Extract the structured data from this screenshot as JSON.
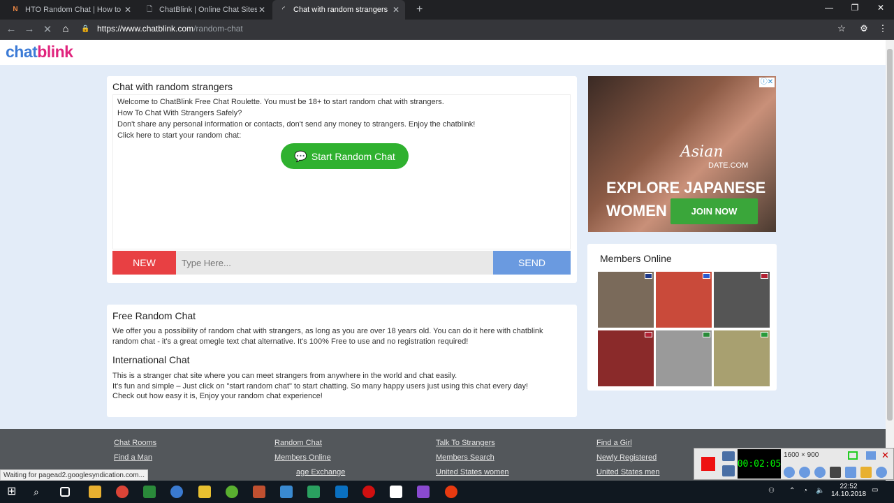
{
  "browser": {
    "tabs": [
      {
        "title": "HTO Random Chat | How to Chat",
        "icon": "news-icon"
      },
      {
        "title": "ChatBlink | Online Chat Sites",
        "icon": "document-icon"
      },
      {
        "title": "Chat with random strangers",
        "icon": "loading-icon"
      }
    ],
    "new_tab": "+",
    "url_host": "https://www.chatblink.com",
    "url_path": "/random-chat"
  },
  "site": {
    "logo_part1": "chat",
    "logo_part2": "blink"
  },
  "chat": {
    "title": "Chat with random strangers",
    "lines": [
      "Welcome to ChatBlink Free Chat Roulette. You must be 18+ to start random chat with strangers.",
      "How To Chat With Strangers Safely?",
      "Don't share any personal information or contacts, don't send any money to strangers. Enjoy the chatblink!",
      "Click here to start your random chat:"
    ],
    "start_label": "Start Random Chat",
    "new_label": "NEW",
    "input_placeholder": "Type Here...",
    "send_label": "SEND"
  },
  "info": {
    "h1": "Free Random Chat",
    "p1": "We offer you a possibility of random chat with strangers, as long as you are over 18 years old. You can do it here with chatblink random chat - it's a great omegle text chat alternative. It's 100% Free to use and no registration required!",
    "h2": "International Chat",
    "p2_lines": [
      "This is a stranger chat site where you can meet strangers from anywhere in the world and chat easily.",
      "It's fun and simple – Just click on \"start random chat\" to start chatting. So many happy users just using this chat every day!",
      "Check out how easy it is, Enjoy your random chat experience!"
    ]
  },
  "ad": {
    "brand": "Asian",
    "brand2": "DATE.COM",
    "headline1": "EXPLORE JAPANESE",
    "headline2": "WOMEN",
    "cta": "JOIN NOW"
  },
  "members": {
    "title": "Members Online",
    "photos": [
      {
        "bg": "#7a6a5a",
        "flag": "#1f3a8a"
      },
      {
        "bg": "#c94a3a",
        "flag": "#2a5bd0"
      },
      {
        "bg": "#555555",
        "flag": "#b22234"
      },
      {
        "bg": "#8a2a2a",
        "flag": "#b22234"
      },
      {
        "bg": "#9a9a9a",
        "flag": "#2a8a3a"
      },
      {
        "bg": "#a8a070",
        "flag": "#2a9a3a"
      }
    ]
  },
  "footer": {
    "col1": [
      "Chat Rooms",
      "Find a Man"
    ],
    "col2": [
      "Random Chat",
      "Members Online",
      "age Exchange"
    ],
    "col3": [
      "Talk To Strangers",
      "Members Search",
      "United States women"
    ],
    "col4": [
      "Find a Girl",
      "Newly Registered",
      "United States men"
    ]
  },
  "status_text": "Waiting for pagead2.googlesyndication.com...",
  "recorder": {
    "time": "00:02:05",
    "resolution": "1600 × 900"
  },
  "taskbar": {
    "time": "22:52",
    "date": "14.10.2018"
  }
}
